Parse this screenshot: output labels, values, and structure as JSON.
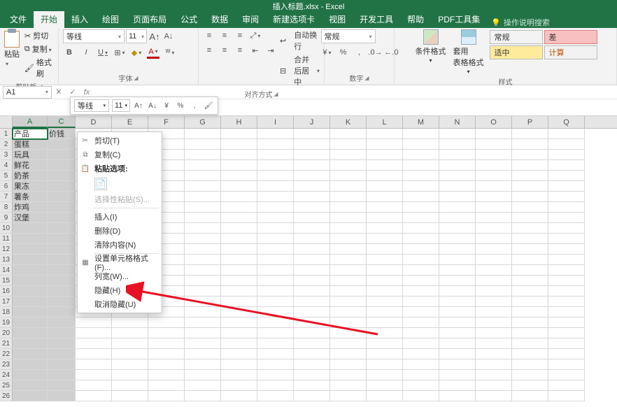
{
  "title": "插入标题.xlsx - Excel",
  "tabs": [
    "文件",
    "开始",
    "插入",
    "绘图",
    "页面布局",
    "公式",
    "数据",
    "审阅",
    "新建选项卡",
    "视图",
    "开发工具",
    "帮助",
    "PDF工具集"
  ],
  "activeTab": 1,
  "tellMe": "操作说明搜索",
  "ribbon": {
    "clipboard": {
      "paste": "粘贴",
      "cut": "剪切",
      "copy": "复制",
      "fmt": "格式刷",
      "label": "剪贴板"
    },
    "font": {
      "name": "等线",
      "size": "11",
      "label": "字体"
    },
    "align": {
      "wrap": "自动换行",
      "merge": "合并后居中",
      "label": "对齐方式"
    },
    "number": {
      "fmt": "常规",
      "label": "数字"
    },
    "styles": {
      "cond": "条件格式",
      "table": "套用\n表格格式",
      "cells": [
        [
          "常规",
          ""
        ],
        [
          "适中",
          "计算"
        ]
      ],
      "bad": "差",
      "label": "样式"
    }
  },
  "nameBox": "A1",
  "miniToolbar": {
    "font": "等线",
    "size": "11"
  },
  "columns": [
    "A",
    "C",
    "D",
    "E",
    "F",
    "G",
    "H",
    "I",
    "J",
    "K",
    "L",
    "M",
    "N",
    "O",
    "P",
    "Q"
  ],
  "colSelected": [
    "A",
    "C"
  ],
  "rows": [
    {
      "n": 1,
      "A": "产品",
      "C": "价钱"
    },
    {
      "n": 2,
      "A": "蛋糕"
    },
    {
      "n": 3,
      "A": "玩具"
    },
    {
      "n": 4,
      "A": "鲜花"
    },
    {
      "n": 5,
      "A": "奶茶"
    },
    {
      "n": 6,
      "A": "果冻"
    },
    {
      "n": 7,
      "A": "薯条"
    },
    {
      "n": 8,
      "A": "炸鸡"
    },
    {
      "n": 9,
      "A": "汉堡"
    },
    {
      "n": 10
    },
    {
      "n": 11
    },
    {
      "n": 12
    },
    {
      "n": 13
    },
    {
      "n": 14
    },
    {
      "n": 15
    },
    {
      "n": 16
    },
    {
      "n": 17
    },
    {
      "n": 18
    },
    {
      "n": 19
    },
    {
      "n": 20
    },
    {
      "n": 21
    },
    {
      "n": 22
    },
    {
      "n": 23
    },
    {
      "n": 24
    },
    {
      "n": 25
    },
    {
      "n": 26
    }
  ],
  "contextMenu": {
    "cut": "剪切(T)",
    "copy": "复制(C)",
    "pasteOpt": "粘贴选项:",
    "pasteSpecial": "选择性粘贴(S)...",
    "insert": "插入(I)",
    "delete": "删除(D)",
    "clear": "清除内容(N)",
    "formatCells": "设置单元格格式(F)...",
    "colWidth": "列宽(W)...",
    "hide": "隐藏(H)",
    "unhide": "取消隐藏(U)"
  }
}
